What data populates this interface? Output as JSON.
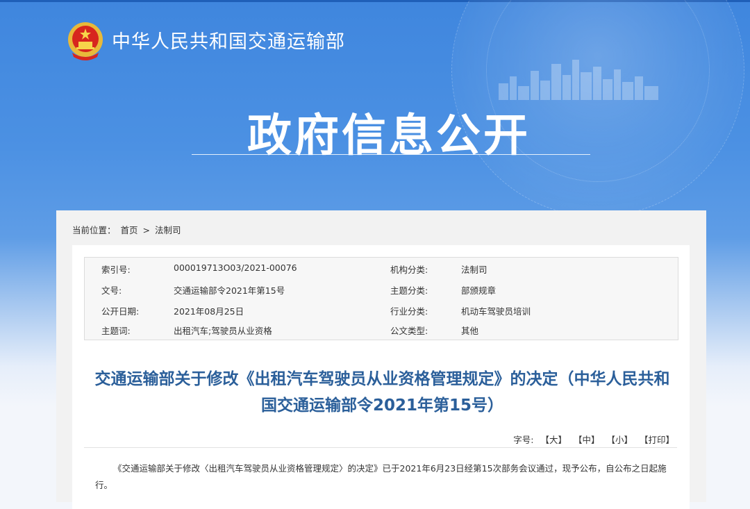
{
  "header": {
    "site_name": "中华人民共和国交通运输部",
    "page_title": "政府信息公开"
  },
  "breadcrumb": {
    "prefix": "当前位置：",
    "home": "首页",
    "separator": ">",
    "current": "法制司"
  },
  "metadata": {
    "index_label": "索引号:",
    "index_value": "000019713O03/2021-00076",
    "org_label": "机构分类:",
    "org_value": "法制司",
    "docno_label": "文号:",
    "docno_value": "交通运输部令2021年第15号",
    "theme_label": "主题分类:",
    "theme_value": "部颁规章",
    "date_label": "公开日期:",
    "date_value": "2021年08月25日",
    "industry_label": "行业分类:",
    "industry_value": "机动车驾驶员培训",
    "keywords_label": "主题词:",
    "keywords_value": "出租汽车;驾驶员从业资格",
    "type_label": "公文类型:",
    "type_value": "其他"
  },
  "document": {
    "title": "交通运输部关于修改《出租汽车驾驶员从业资格管理规定》的决定（中华人民共和国交通运输部令2021年第15号）",
    "body": "《交通运输部关于修改〈出租汽车驾驶员从业资格管理规定〉的决定》已于2021年6月23日经第15次部务会议通过，现予公布，自公布之日起施行。"
  },
  "font_size_bar": {
    "label": "字号:",
    "large": "【大】",
    "medium": "【中】",
    "small": "【小】",
    "print": "【打印】"
  },
  "colors": {
    "banner_blue": "#3f86de",
    "title_blue": "#2b5f9a"
  }
}
